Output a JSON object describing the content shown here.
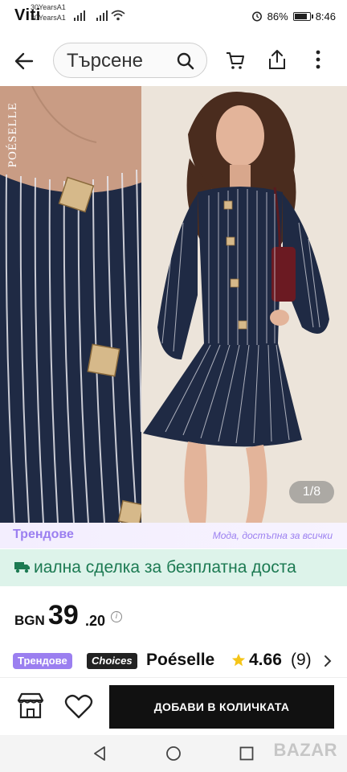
{
  "status_bar": {
    "carrier_logo": "Viti",
    "carrier_line1": "30YearsA1",
    "carrier_line2": "30YearsA1",
    "battery_percent": "86%",
    "battery_level": 0.86,
    "time": "8:46"
  },
  "header": {
    "search_placeholder": "Търсене"
  },
  "gallery": {
    "brand_watermark": "POÉSELLE",
    "page_indicator": "1/8",
    "fabric_color": "#1f2a44",
    "stripe_color": "#e8e8ee",
    "button_color": "#d6b98a"
  },
  "trend_strip": {
    "logo": "Трендове",
    "tagline": "Мода, достъпна за всички",
    "accent": "#9b7ff0"
  },
  "shipping": {
    "text": "иална сделка за безплатна доста",
    "color": "#1c7a52",
    "background": "#ddf3ea"
  },
  "price": {
    "currency": "BGN",
    "integer": "39",
    "decimal": ".20",
    "info_icon": "i"
  },
  "store": {
    "badge_trend": "Трендове",
    "badge_choices": "Choices",
    "name": "Poéselle",
    "rating": "4.66",
    "rating_count": "(9)",
    "star_color": "#f5c518"
  },
  "actions": {
    "add_to_cart": "ДОБАВИ В КОЛИЧКАТА"
  },
  "nav_bar": {
    "watermark": "BAZAR"
  }
}
